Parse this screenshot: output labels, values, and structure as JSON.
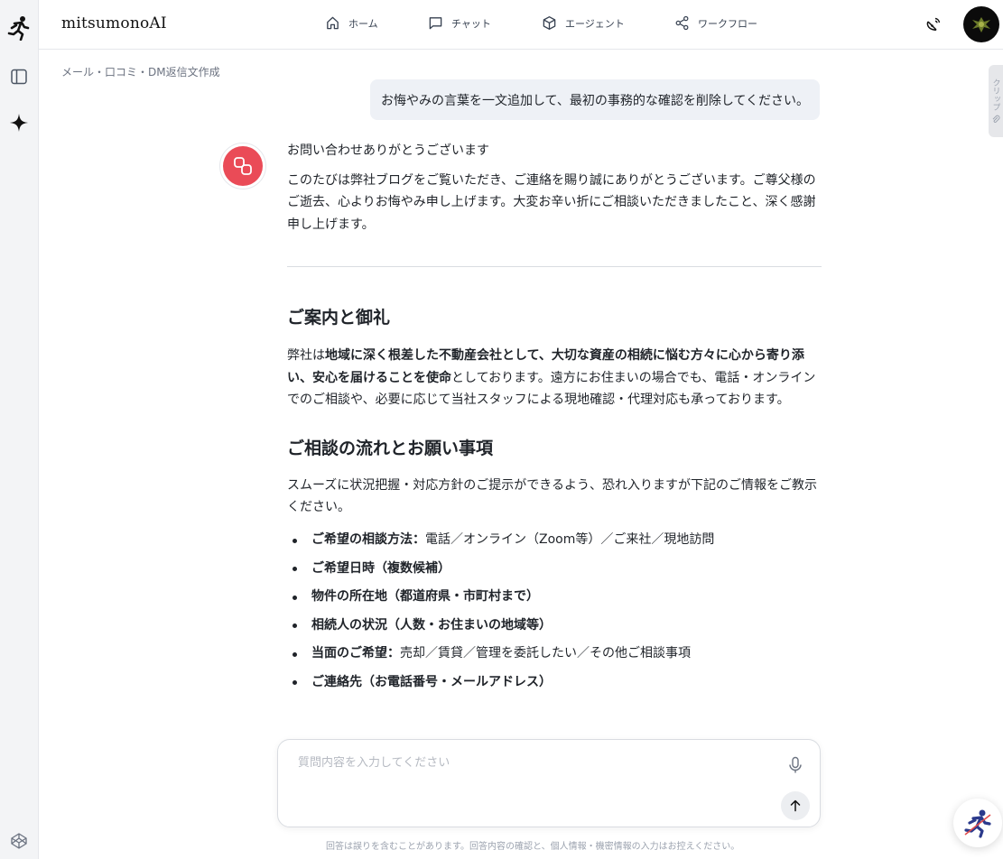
{
  "brand": "mitsumonoAI",
  "nav": [
    {
      "label": "ホーム",
      "icon": "home-icon"
    },
    {
      "label": "チャット",
      "icon": "chat-icon"
    },
    {
      "label": "エージェント",
      "icon": "cube-icon"
    },
    {
      "label": "ワークフロー",
      "icon": "share-icon"
    }
  ],
  "breadcrumb": "メール・口コミ・DM返信文作成",
  "user_message": "お悔やみの言葉を一文追加して、最初の事務的な確認を削除してください。",
  "clip_tab_label": "クリップ",
  "answer": {
    "greeting": "お問い合わせありがとうございます",
    "intro": "このたびは弊社ブログをご覧いただき、ご連絡を賜り誠にありがとうございます。ご尊父様のご逝去、心よりお悔やみ申し上げます。大変お辛い折にご相談いただきましたこと、深く感謝申し上げます。",
    "section1_title": "ご案内と御礼",
    "section1_pre": "弊社は",
    "section1_bold": "地域に深く根差した不動産会社として、大切な資産の相続に悩む方々に心から寄り添い、安心を届けることを使命",
    "section1_post": "としております。遠方にお住まいの場合でも、電話・オンラインでのご相談や、必要に応じて当社スタッフによる現地確認・代理対応も承っております。",
    "section2_title": "ご相談の流れとお願い事項",
    "section2_para": "スムーズに状況把握・対応方針のご提示ができるよう、恐れ入りますが下記のご情報をご教示ください。",
    "list": [
      {
        "bold": "ご希望の相談方法：",
        "text": "電話／オンライン（Zoom等）／ご来社／現地訪問"
      },
      {
        "bold": "ご希望日時（複数候補）",
        "text": ""
      },
      {
        "bold": "物件の所在地（都道府県・市町村まで）",
        "text": ""
      },
      {
        "bold": "相続人の状況（人数・お住まいの地域等）",
        "text": ""
      },
      {
        "bold": "当面のご希望：",
        "text": "売却／賃貸／管理を委託したい／その他ご相談事項"
      },
      {
        "bold": "ご連絡先（お電話番号・メールアドレス）",
        "text": ""
      }
    ]
  },
  "composer": {
    "placeholder": "質問内容を入力してください"
  },
  "disclaimer": "回答は誤りを含むことがあります。回答内容の確認と、個人情報・機密情報の入力はお控えください。",
  "colors": {
    "bot_avatar": "#ea4b57",
    "bubble": "#eef1f6",
    "rail": "#f3f4f6"
  }
}
